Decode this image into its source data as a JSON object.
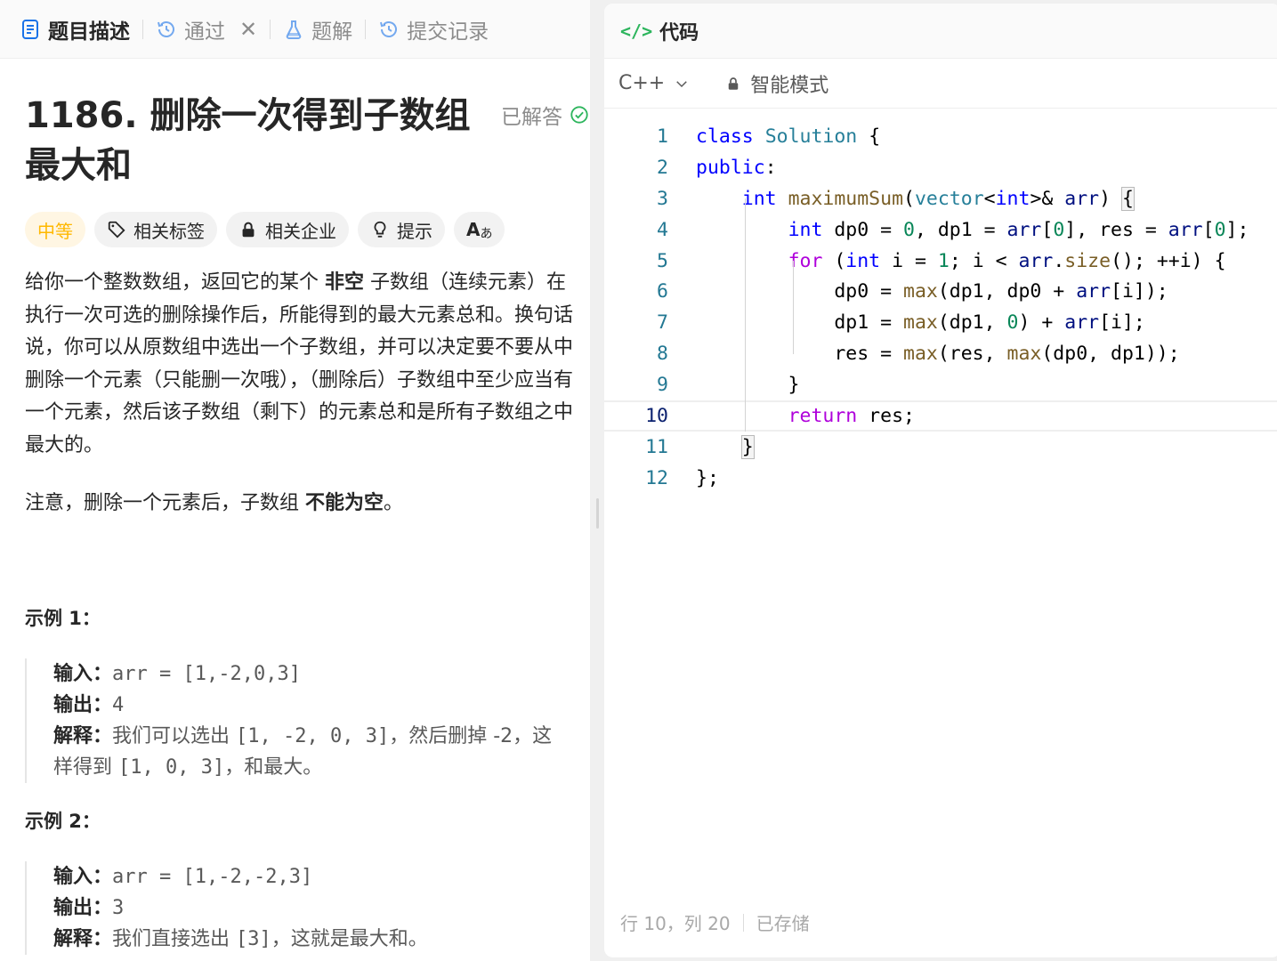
{
  "left_tabs": [
    {
      "label": "题目描述",
      "icon": "document-icon",
      "active": true
    },
    {
      "label": "通过",
      "icon": "history-icon",
      "closable": true
    },
    {
      "label": "题解",
      "icon": "flask-icon"
    },
    {
      "label": "提交记录",
      "icon": "history-icon"
    }
  ],
  "problem": {
    "title": "1186. 删除一次得到子数组最大和",
    "solved_label": "已解答",
    "tags": {
      "difficulty": "中等",
      "related_tags": "相关标签",
      "related_companies": "相关企业",
      "hint": "提示",
      "font_toggle": "A"
    },
    "description": {
      "part1": "给你一个整数数组，返回它的某个 ",
      "bold1": "非空",
      "part2": " 子数组（连续元素）在执行一次可选的删除操作后，所能得到的最大元素总和。换句话说，你可以从原数组中选出一个子数组，并可以决定要不要从中删除一个元素（只能删一次哦），（删除后）子数组中至少应当有一个元素，然后该子数组（剩下）的元素总和是所有子数组之中最大的。"
    },
    "note": {
      "part1": "注意，删除一个元素后，子数组 ",
      "bold1": "不能为空",
      "part2": "。"
    },
    "examples": [
      {
        "title": "示例 1：",
        "input_label": "输入：",
        "input": "arr = [1,-2,0,3]",
        "output_label": "输出：",
        "output": "4",
        "explain_label": "解释：",
        "explain_part1": "我们可以选出 ",
        "explain_code1": "[1, -2, 0, 3]",
        "explain_part2": "，然后删掉 -2，这样得到 ",
        "explain_code2": "[1, 0, 3]",
        "explain_part3": "，和最大。"
      },
      {
        "title": "示例 2：",
        "input_label": "输入：",
        "input": "arr = [1,-2,-2,3]",
        "output_label": "输出：",
        "output": "3",
        "explain_label": "解释：",
        "explain_part1": "我们直接选出 ",
        "explain_code1": "[3]",
        "explain_part2": "，这就是最大和。"
      }
    ]
  },
  "editor": {
    "header_icon": "</>",
    "header_title": "代码",
    "language": "C++",
    "mode": "智能模式",
    "lines": [
      {
        "n": "1",
        "code": "class Solution {"
      },
      {
        "n": "2",
        "code": "public:"
      },
      {
        "n": "3",
        "code": "    int maximumSum(vector<int>& arr) {"
      },
      {
        "n": "4",
        "code": "        int dp0 = 0, dp1 = arr[0], res = arr[0];"
      },
      {
        "n": "5",
        "code": "        for (int i = 1; i < arr.size(); ++i) {"
      },
      {
        "n": "6",
        "code": "            dp0 = max(dp1, dp0 + arr[i]);"
      },
      {
        "n": "7",
        "code": "            dp1 = max(dp1, 0) + arr[i];"
      },
      {
        "n": "8",
        "code": "            res = max(res, max(dp0, dp1));"
      },
      {
        "n": "9",
        "code": "        }"
      },
      {
        "n": "10",
        "code": "        return res;"
      },
      {
        "n": "11",
        "code": "    }"
      },
      {
        "n": "12",
        "code": "};"
      }
    ],
    "current_line": 10,
    "status_position": "行 10，列 20",
    "status_saved": "已存储"
  },
  "colors": {
    "difficulty_medium": "#ffb800",
    "accent_green": "#2db55d",
    "keyword": "#0000ff",
    "type": "#267f99",
    "function": "#795e26",
    "number": "#098658",
    "control": "#af00db"
  }
}
